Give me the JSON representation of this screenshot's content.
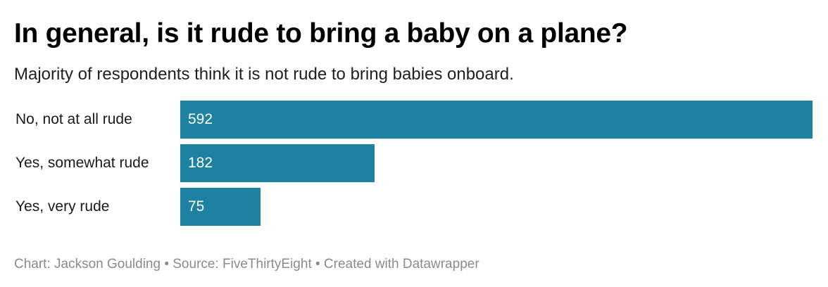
{
  "header": {
    "title": "In general, is it rude to bring a baby on a plane?",
    "subtitle": "Majority of respondents think it is not rude to bring babies onboard."
  },
  "footer": {
    "credit": "Chart: Jackson Goulding • Source: FiveThirtyEight • Created with Datawrapper"
  },
  "colors": {
    "bar": "#1d81a2",
    "footer_text": "#8a8a8a"
  },
  "chart_data": {
    "type": "bar",
    "orientation": "horizontal",
    "title": "In general, is it rude to bring a baby on a plane?",
    "subtitle": "Majority of respondents think it is not rude to bring babies onboard.",
    "categories": [
      "No, not at all rude",
      "Yes, somewhat rude",
      "Yes, very rude"
    ],
    "values": [
      592,
      182,
      75
    ],
    "value_labels": [
      "592",
      "182",
      "75"
    ],
    "xlim": [
      0,
      592
    ],
    "grid": false,
    "legend": "none"
  }
}
